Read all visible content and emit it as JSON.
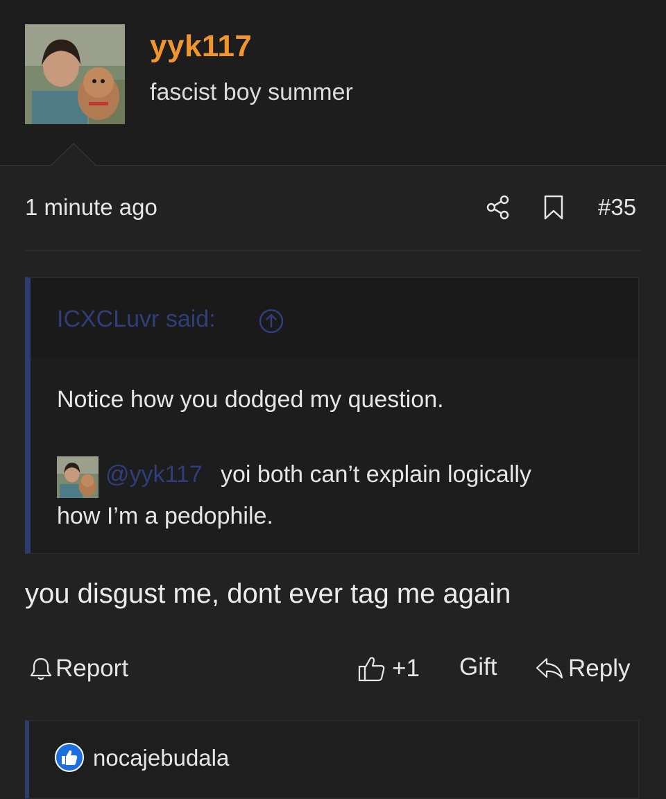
{
  "post": {
    "author": "yyk117",
    "user_title": "fascist boy summer",
    "timestamp": "1 minute ago",
    "post_number": "#35",
    "body": "you disgust me, dont ever tag me again"
  },
  "quote": {
    "attribution": "ICXCLuvr said:",
    "line1": "Notice how you dodged my question.",
    "mention": "@yyk117",
    "line2a": "yoi both can’t explain logically",
    "line2b": "how I’m a pedophile."
  },
  "actions": {
    "report_label": "Report",
    "like_count": "+1",
    "gift_label": "Gift",
    "reply_label": "Reply"
  },
  "reactions": {
    "user": "nocajebudala",
    "icon": "thumbs-up-icon"
  },
  "colors": {
    "username": "#f0962c",
    "link": "#2f3d7a",
    "quote_border": "#2f3c6e",
    "like_reaction": "#1d6fe0"
  }
}
